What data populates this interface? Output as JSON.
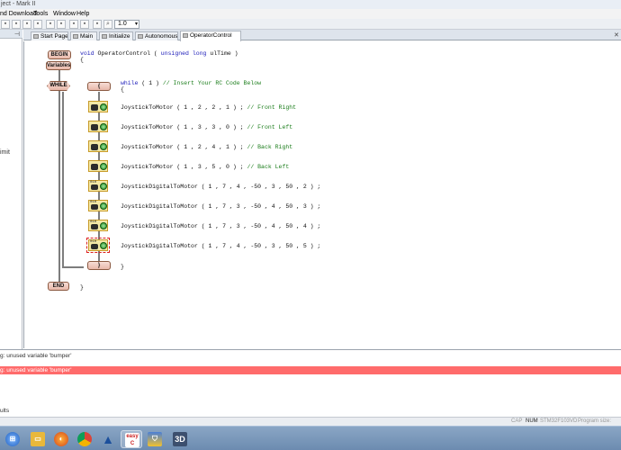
{
  "title_bar": {
    "text": "ject - Mark II"
  },
  "menu": {
    "items": [
      {
        "label": "nd Download"
      },
      {
        "label": "Tools"
      },
      {
        "label": "Window"
      },
      {
        "label": "Help"
      }
    ]
  },
  "toolbar": {
    "zoom_value": "1.0"
  },
  "left_panel": {
    "fragment_text": "imit"
  },
  "tabs": [
    {
      "label": "Start Page"
    },
    {
      "label": "Main"
    },
    {
      "label": "Initialize"
    },
    {
      "label": "Autonomous"
    },
    {
      "label": "OperatorControl",
      "active": true
    }
  ],
  "editor": {
    "begin_label": "BEGIN",
    "variables_label": "Variables",
    "while_label": "WHILE",
    "open_brace_label": "{",
    "close_brace_label": "}",
    "end_label": "END",
    "signature_line": {
      "kw1": "void",
      "name": " OperatorControl ( ",
      "kw2": "unsigned long",
      "rest": " ulTime )"
    },
    "brace_open": "{",
    "while_line": {
      "kw": "while",
      "mid": " ( 1 ) ",
      "comment": "// Insert Your RC Code Below"
    },
    "while_brace": "{",
    "statements": [
      {
        "code": "JoystickToMotor ( 1 , 2 , 2 , 1 ) ; ",
        "comment": "// Front Right"
      },
      {
        "code": "JoystickToMotor ( 1 , 3 , 3 , 0 ) ; ",
        "comment": "// Front Left"
      },
      {
        "code": "JoystickToMotor ( 1 , 2 , 4 , 1 ) ; ",
        "comment": "// Back Right"
      },
      {
        "code": "JoystickToMotor ( 1 , 3 , 5 , 0 ) ; ",
        "comment": "// Back Left"
      },
      {
        "code": "JoystickDigitalToMotor ( 1 , 7 , 4 , -50 , 3 , 50 , 2 ) ;",
        "comment": ""
      },
      {
        "code": "JoystickDigitalToMotor ( 1 , 7 , 3 , -50 , 4 , 50 , 3 ) ;",
        "comment": ""
      },
      {
        "code": "JoystickDigitalToMotor ( 1 , 7 , 3 , -50 , 4 , 50 , 4 ) ;",
        "comment": ""
      },
      {
        "code": "JoystickDigitalToMotor ( 1 , 7 , 4 , -50 , 3 , 50 , 5 ) ;",
        "comment": ""
      }
    ],
    "while_close": "}",
    "func_close": "}"
  },
  "output": {
    "lines": [
      {
        "text": "g: unused variable 'bumper'",
        "error": false
      },
      {
        "text": "g: unused variable 'bumper'",
        "error": true
      }
    ],
    "panel_label": "ults"
  },
  "statusbar": {
    "cap": "CAP",
    "num": "NUM",
    "device": "STM32F103VD",
    "program": "Program size: Unkno"
  },
  "colors": {
    "error_row": "#ff6b6b",
    "comment": "#1b7d1b",
    "keyword": "#1a1ab8",
    "block_fill": "#e8b8aa"
  },
  "taskbar": {
    "icons": [
      "windows-start",
      "explorer",
      "firefox",
      "chrome",
      "arduino",
      "easyc",
      "warning-shield",
      "3d-app"
    ],
    "label_3d": "3D"
  }
}
